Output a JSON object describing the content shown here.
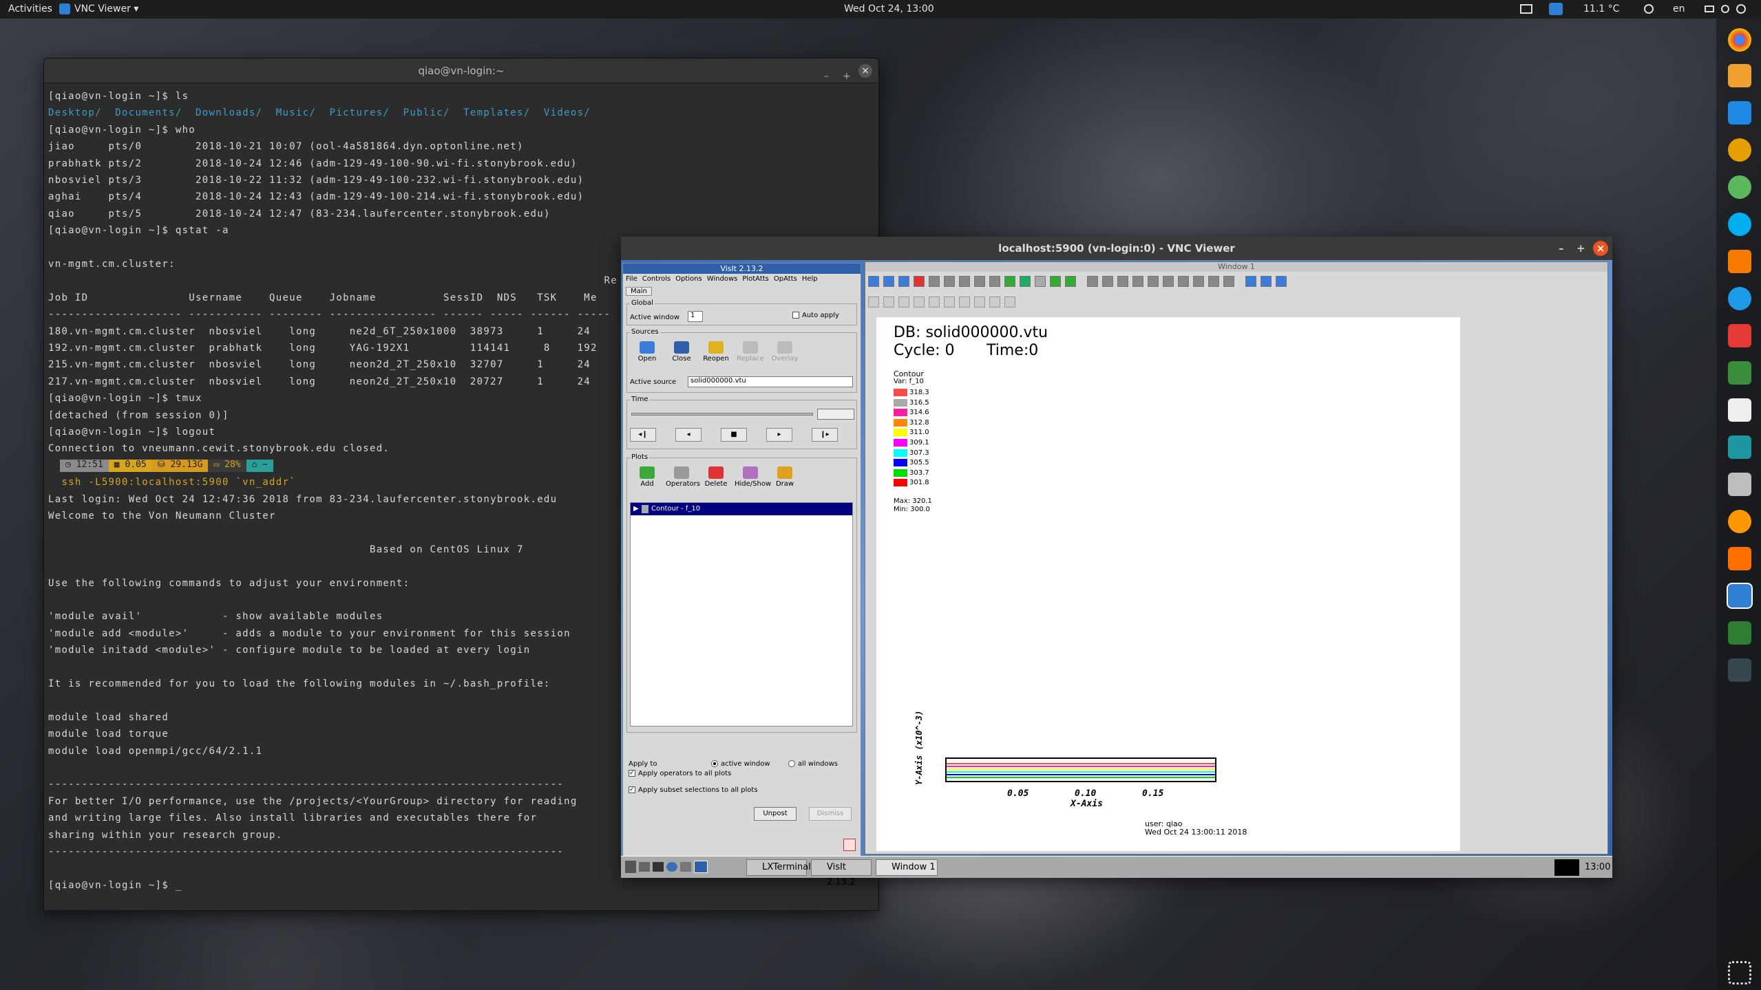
{
  "topbar": {
    "activities": "Activities",
    "app": "VNC Viewer ▾",
    "datetime": "Wed Oct 24, 13:00",
    "weather": "11.1 °C",
    "lang": "en"
  },
  "terminal": {
    "title": "qiao@vn-login:~",
    "lines": [
      {
        "t": "[qiao@vn-login ~]$ ls"
      },
      {
        "t": "Desktop/  Documents/  Downloads/  Music/  Pictures/  Public/  Templates/  Videos/",
        "c": "blue"
      },
      {
        "t": "[qiao@vn-login ~]$ who"
      },
      {
        "t": "jiao     pts/0        2018-10-21 10:07 (ool-4a581864.dyn.optonline.net)"
      },
      {
        "t": "prabhatk pts/2        2018-10-24 12:46 (adm-129-49-100-90.wi-fi.stonybrook.edu)"
      },
      {
        "t": "nbosviel pts/3        2018-10-22 11:32 (adm-129-49-100-232.wi-fi.stonybrook.edu)"
      },
      {
        "t": "aghai    pts/4        2018-10-24 12:43 (adm-129-49-100-214.wi-fi.stonybrook.edu)"
      },
      {
        "t": "qiao     pts/5        2018-10-24 12:47 (83-234.laufercenter.stonybrook.edu)"
      },
      {
        "t": "[qiao@vn-login ~]$ qstat -a"
      },
      {
        "t": ""
      },
      {
        "t": "vn-mgmt.cm.cluster:"
      },
      {
        "t": "                                                                                   Re"
      },
      {
        "t": "Job ID               Username    Queue    Jobname          SessID  NDS   TSK    Me"
      },
      {
        "t": "-------------------- ----------- -------- ---------------- ------ ----- ------ -----"
      },
      {
        "t": "180.vn-mgmt.cm.cluster  nbosviel    long     ne2d_6T_250x1000  38973     1     24"
      },
      {
        "t": "192.vn-mgmt.cm.cluster  prabhatk    long     YAG-192X1         114141     8    192"
      },
      {
        "t": "215.vn-mgmt.cm.cluster  nbosviel    long     neon2d_2T_250x10  32707     1     24"
      },
      {
        "t": "217.vn-mgmt.cm.cluster  nbosviel    long     neon2d_2T_250x10  20727     1     24"
      },
      {
        "t": "[qiao@vn-login ~]$ tmux"
      },
      {
        "t": "[detached (from session 0)]"
      },
      {
        "t": "[qiao@vn-login ~]$ logout"
      },
      {
        "t": "Connection to vneumann.cewit.stonybrook.edu closed."
      },
      {
        "t": ""
      },
      {
        "t": "  ssh -L5900:localhost:5900 `vn_addr`",
        "c": "yel"
      },
      {
        "t": "Last login: Wed Oct 24 12:47:36 2018 from 83-234.laufercenter.stonybrook.edu"
      },
      {
        "t": "Welcome to the Von Neumann Cluster"
      },
      {
        "t": ""
      },
      {
        "t": "                                                Based on CentOS Linux 7"
      },
      {
        "t": ""
      },
      {
        "t": "Use the following commands to adjust your environment:"
      },
      {
        "t": ""
      },
      {
        "t": "'module avail'            - show available modules"
      },
      {
        "t": "'module add <module>'     - adds a module to your environment for this session"
      },
      {
        "t": "'module initadd <module>' - configure module to be loaded at every login"
      },
      {
        "t": ""
      },
      {
        "t": "It is recommended for you to load the following modules in ~/.bash_profile:"
      },
      {
        "t": ""
      },
      {
        "t": "module load shared"
      },
      {
        "t": "module load torque"
      },
      {
        "t": "module load openmpi/gcc/64/2.1.1"
      },
      {
        "t": ""
      },
      {
        "t": "-----------------------------------------------------------------------------"
      },
      {
        "t": "For better I/O performance, use the /projects/<YourGroup> directory for reading"
      },
      {
        "t": "and writing large files. Also install libraries and executables there for"
      },
      {
        "t": "sharing within your research group."
      },
      {
        "t": "-----------------------------------------------------------------------------"
      },
      {
        "t": ""
      },
      {
        "t": "[qiao@vn-login ~]$ _"
      }
    ],
    "powerline": {
      "time": "12:51",
      "load": "0.05",
      "mem": "29.13G",
      "bat": "28%",
      "dir": "~"
    }
  },
  "vnc": {
    "title": "localhost:5900 (vn-login:0) - VNC Viewer"
  },
  "visit": {
    "title": "VisIt 2.13.2",
    "menu": [
      "File",
      "Controls",
      "Options",
      "Windows",
      "PlotAtts",
      "OpAtts",
      "Help"
    ],
    "tab": "Main",
    "global": "Global",
    "active_window_label": "Active window",
    "active_window_value": "1",
    "auto_apply": "Auto apply",
    "sources": "Sources",
    "src_buttons": [
      "Open",
      "Close",
      "Reopen",
      "Replace",
      "Overlay"
    ],
    "active_source_label": "Active source",
    "active_source_value": "solid000000.vtu",
    "time": "Time",
    "plots": "Plots",
    "plot_buttons": [
      "Add",
      "Operators",
      "Delete",
      "Hide/Show",
      "Draw"
    ],
    "plot_item": "Contour - f_10",
    "apply_to": "Apply to",
    "active_window": "active window",
    "all_windows": "all windows",
    "apply_ops": "Apply operators to all plots",
    "apply_subset": "Apply subset selections to all plots",
    "unpost": "Unpost",
    "dismiss": "Dismiss"
  },
  "window1": {
    "title": "Window 1",
    "db": "DB: solid000000.vtu",
    "cycle": "Cycle: 0",
    "time": "Time:0",
    "legend_title": "Contour",
    "legend_var": "Var: f_10",
    "legend": [
      {
        "v": "318.3",
        "color": "#ff4a4a"
      },
      {
        "v": "316.5",
        "color": "#a9a9a9"
      },
      {
        "v": "314.6",
        "color": "#ff1fa0"
      },
      {
        "v": "312.8",
        "color": "#ff8800"
      },
      {
        "v": "311.0",
        "color": "#ffff00"
      },
      {
        "v": "309.1",
        "color": "#ff00ff"
      },
      {
        "v": "307.3",
        "color": "#00ffff"
      },
      {
        "v": "305.5",
        "color": "#0000ff"
      },
      {
        "v": "303.7",
        "color": "#00dd00"
      },
      {
        "v": "301.8",
        "color": "#ff0000"
      }
    ],
    "max": "Max: 320.1",
    "min": "Min: 300.0",
    "ylabel": "Y-Axis (x10^-3)",
    "xlabel": "X-Axis",
    "xticks": [
      "0.05",
      "0.10",
      "0.15"
    ],
    "user": "user: qiao",
    "date": "Wed Oct 24 13:00:11 2018"
  },
  "taskbar": {
    "items": [
      "LXTerminal",
      "VisIt 2.13.2",
      "Window 1"
    ],
    "clock": "13:00"
  }
}
